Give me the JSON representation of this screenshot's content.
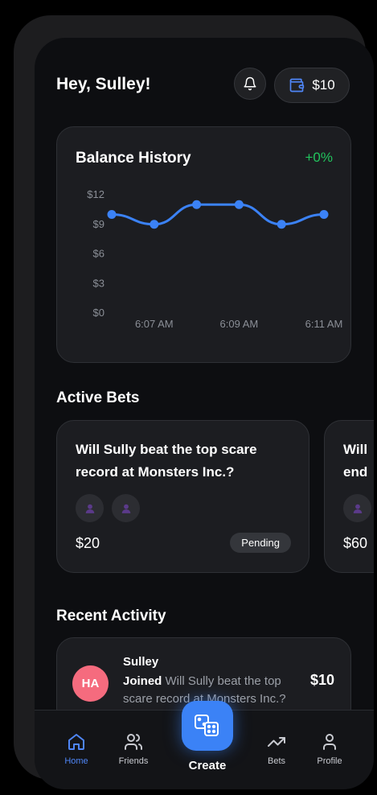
{
  "header": {
    "greeting": "Hey, Sulley!",
    "wallet_amount": "$10"
  },
  "balance": {
    "title": "Balance History",
    "change": "+0%"
  },
  "chart_data": {
    "type": "line",
    "x": [
      "6:06 AM",
      "6:07 AM",
      "6:08 AM",
      "6:09 AM",
      "6:10 AM",
      "6:11 AM"
    ],
    "x_tick_labels": [
      "6:07 AM",
      "6:09 AM",
      "6:11 AM"
    ],
    "y": [
      10,
      9,
      11,
      11,
      9,
      10
    ],
    "y_tick_labels": [
      "$12",
      "$9",
      "$6",
      "$3",
      "$0"
    ],
    "ylim": [
      0,
      12
    ],
    "grid": false,
    "color": "#3b82f6"
  },
  "active_bets": {
    "title": "Active Bets",
    "bets": [
      {
        "question": "Will Sully beat the top scare record at Monsters Inc.?",
        "amount": "$20",
        "status": "Pending"
      },
      {
        "question": "Will",
        "question_line2": "end",
        "amount": "$60"
      }
    ]
  },
  "recent_activity": {
    "title": "Recent Activity",
    "items": [
      {
        "initials": "HA",
        "name": "Sulley",
        "action": "Joined",
        "text": "Will Sully beat the top scare record at Monsters Inc.?",
        "amount": "$10"
      }
    ]
  },
  "nav": {
    "items": [
      {
        "label": "Home",
        "icon": "home-icon"
      },
      {
        "label": "Friends",
        "icon": "users-icon"
      },
      {
        "label": "Create",
        "icon": "dice-icon"
      },
      {
        "label": "Bets",
        "icon": "trending-up-icon"
      },
      {
        "label": "Profile",
        "icon": "user-icon"
      }
    ]
  }
}
